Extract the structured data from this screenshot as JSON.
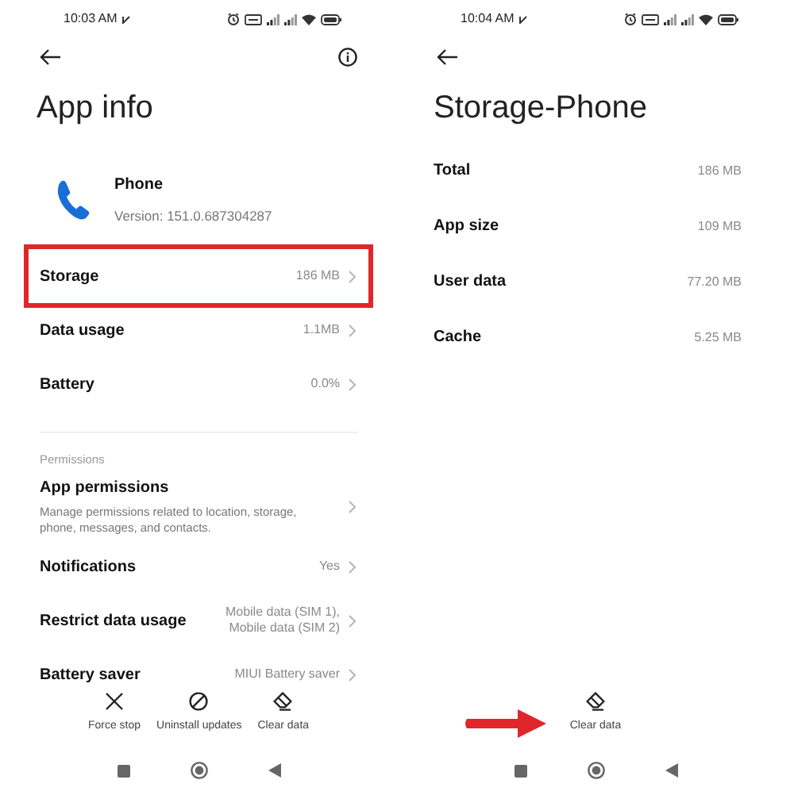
{
  "app_info_screen": {
    "status_bar": {
      "time": "10:03 AM"
    },
    "title": "App info",
    "app": {
      "name": "Phone",
      "version": "Version: 151.0.687304287"
    },
    "rows": [
      {
        "label": "Storage",
        "value": "186 MB",
        "highlighted": true
      },
      {
        "label": "Data usage",
        "value": "1.1MB",
        "highlighted": false
      },
      {
        "label": "Battery",
        "value": "0.0%",
        "highlighted": false
      }
    ],
    "section_label": "Permissions",
    "permission_rows": [
      {
        "label": "App permissions",
        "description": "Manage permissions related to location, storage, phone, messages, and contacts."
      },
      {
        "label": "Notifications",
        "value": "Yes"
      },
      {
        "label": "Restrict data usage",
        "value": "Mobile data (SIM 1), Mobile data (SIM 2)"
      },
      {
        "label": "Battery saver",
        "value": "MIUI Battery saver"
      }
    ],
    "actions": [
      {
        "kind": "force_stop",
        "label": "Force stop",
        "pointed": false
      },
      {
        "kind": "uninstall",
        "label": "Uninstall updates",
        "pointed": false
      },
      {
        "kind": "clear",
        "label": "Clear data",
        "pointed": false
      }
    ]
  },
  "storage_screen": {
    "status_bar": {
      "time": "10:04 AM"
    },
    "title": "Storage-Phone",
    "rows": [
      {
        "label": "Total",
        "value": "186 MB"
      },
      {
        "label": "App size",
        "value": "109 MB"
      },
      {
        "label": "User data",
        "value": "77.20 MB"
      },
      {
        "label": "Cache",
        "value": "5.25 MB"
      }
    ],
    "actions": [
      {
        "kind": "clear",
        "label": "Clear data",
        "pointed": true
      }
    ]
  }
}
